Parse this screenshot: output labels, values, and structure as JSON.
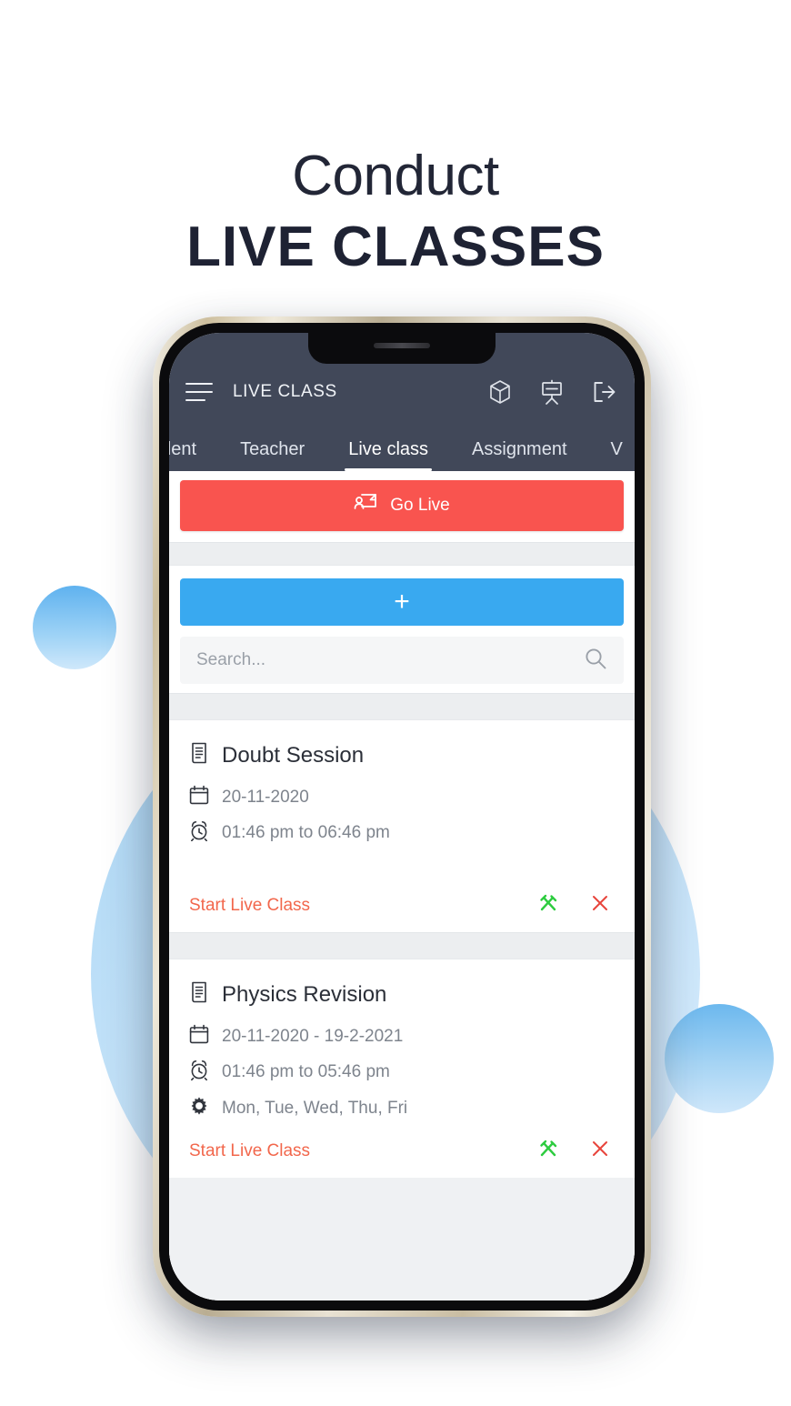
{
  "headline": {
    "line1": "Conduct",
    "line2": "LIVE CLASSES"
  },
  "colors": {
    "appbar": "#414859",
    "go_live_red": "#f9544f",
    "add_blue": "#39a9f0",
    "start_link_orange": "#f2674c",
    "edit_green": "#2ecc40",
    "delete_red": "#e8453c",
    "divider_gray": "#eceef0",
    "headline_dark": "#1e2233",
    "circle_blue": "#6cb8ee"
  },
  "app": {
    "title": "LIVE CLASS",
    "menu_icon": "hamburger-menu-icon",
    "bar_icons": [
      {
        "name": "cube-icon"
      },
      {
        "name": "presentation-board-icon"
      },
      {
        "name": "logout-icon"
      }
    ],
    "tabs": [
      {
        "label": "udent",
        "full": "Student",
        "active": false
      },
      {
        "label": "Teacher",
        "active": false
      },
      {
        "label": "Live class",
        "active": true
      },
      {
        "label": "Assignment",
        "active": false
      },
      {
        "label": "V",
        "active": false
      }
    ],
    "go_live": {
      "label": "Go Live",
      "icon": "screen-share-icon"
    },
    "add_button": {
      "label": "+"
    },
    "search": {
      "value": "",
      "placeholder": "Search...",
      "icon": "search-icon"
    },
    "classes": [
      {
        "title": "Doubt Session",
        "title_icon": "document-icon",
        "date": "20-11-2020",
        "date_icon": "calendar-icon",
        "time": "01:46 pm to 06:46 pm",
        "time_icon": "alarm-clock-icon",
        "days": null,
        "days_icon": "gear-icon",
        "action_label": "Start Live Class",
        "edit_icon": "tools-icon",
        "delete_icon": "close-icon"
      },
      {
        "title": "Physics Revision",
        "title_icon": "document-icon",
        "date": "20-11-2020 - 19-2-2021",
        "date_icon": "calendar-icon",
        "time": "01:46 pm to 05:46 pm",
        "time_icon": "alarm-clock-icon",
        "days": "Mon, Tue, Wed, Thu, Fri",
        "days_icon": "gear-icon",
        "action_label": "Start Live Class",
        "edit_icon": "tools-icon",
        "delete_icon": "close-icon"
      }
    ]
  }
}
